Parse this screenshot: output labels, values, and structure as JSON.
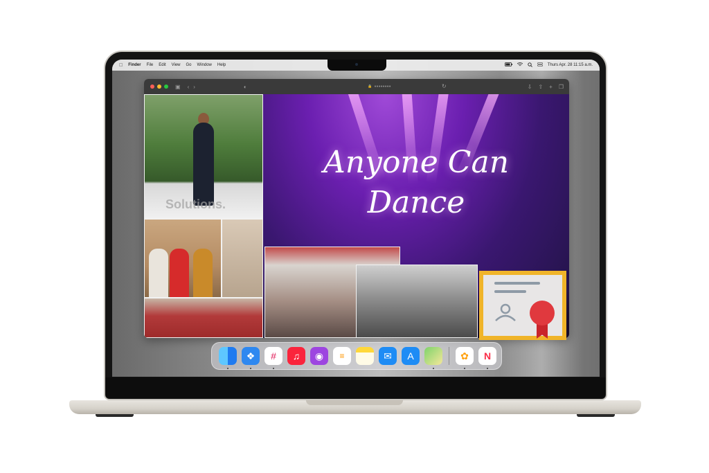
{
  "menubar": {
    "app": "Finder",
    "items": [
      "File",
      "Edit",
      "View",
      "Go",
      "Window",
      "Help"
    ],
    "datetime": "Thurs Apr. 28 11:15 a.m."
  },
  "browser": {
    "url": "●●●●●●●●"
  },
  "hero": {
    "line1": "Anyone Can",
    "line2": "Dance"
  },
  "photos": {
    "watermark": "Solutions."
  },
  "dock": {
    "apps": [
      "Finder",
      "Safari",
      "Slack",
      "Music",
      "Podcasts",
      "Reminders",
      "Notes",
      "Mail",
      "App Store",
      "Maps",
      "Photos",
      "News"
    ]
  },
  "colors": {
    "hero_purple": "#6b1fb0",
    "cert_gold": "#f0b429",
    "seal_red": "#e0393e"
  }
}
